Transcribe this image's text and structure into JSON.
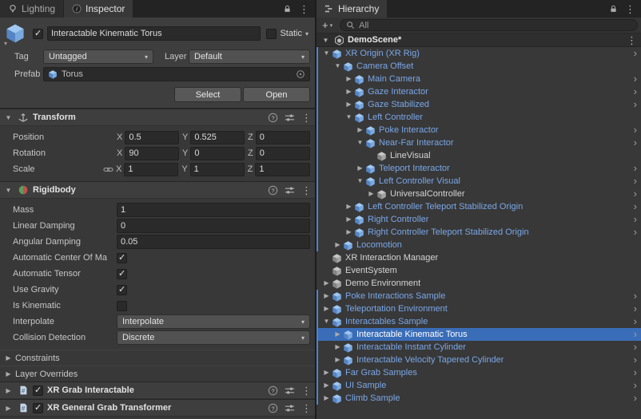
{
  "colors": {
    "selection": "#3a6db8",
    "prefab_text": "#7aa7e8",
    "prefab_bar": "#4f83cc"
  },
  "inspector": {
    "tabs": [
      "Lighting",
      "Inspector"
    ],
    "gameobject": {
      "name": "Interactable Kinematic Torus",
      "static_label": "Static",
      "tag_label": "Tag",
      "tag_value": "Untagged",
      "layer_label": "Layer",
      "layer_value": "Default",
      "prefab_label": "Prefab",
      "prefab_value": "Torus",
      "select_button": "Select",
      "open_button": "Open"
    },
    "transform": {
      "title": "Transform",
      "axis_labels": [
        "X",
        "Y",
        "Z"
      ],
      "rows": [
        {
          "label": "Position",
          "x": "0.5",
          "y": "0.525",
          "z": "0"
        },
        {
          "label": "Rotation",
          "x": "90",
          "y": "0",
          "z": "0"
        },
        {
          "label": "Scale",
          "x": "1",
          "y": "1",
          "z": "1"
        }
      ]
    },
    "rigidbody": {
      "title": "Rigidbody",
      "fields": [
        {
          "label": "Mass",
          "type": "text",
          "value": "1"
        },
        {
          "label": "Linear Damping",
          "type": "text",
          "value": "0"
        },
        {
          "label": "Angular Damping",
          "type": "text",
          "value": "0.05"
        },
        {
          "label": "Automatic Center Of Ma",
          "type": "checkbox",
          "checked": true
        },
        {
          "label": "Automatic Tensor",
          "type": "checkbox",
          "checked": true
        },
        {
          "label": "Use Gravity",
          "type": "checkbox",
          "checked": true
        },
        {
          "label": "Is Kinematic",
          "type": "checkbox",
          "checked": false
        },
        {
          "label": "Interpolate",
          "type": "dropdown",
          "value": "Interpolate"
        },
        {
          "label": "Collision Detection",
          "type": "dropdown",
          "value": "Discrete"
        }
      ],
      "foldouts": [
        "Constraints",
        "Layer Overrides"
      ]
    },
    "extra_components": [
      {
        "title": "XR Grab Interactable",
        "enabled": true
      },
      {
        "title": "XR General Grab Transformer",
        "enabled": true
      }
    ]
  },
  "hierarchy": {
    "tab": "Hierarchy",
    "add_button": "+",
    "search_value": "All",
    "scene": "DemoScene*",
    "rows": [
      {
        "label": "XR Origin (XR Rig)",
        "depth": 1,
        "children": true,
        "expanded": true,
        "icon": "prefab",
        "color": "prefab",
        "bar": true,
        "enter": true
      },
      {
        "label": "Camera Offset",
        "depth": 2,
        "children": true,
        "expanded": true,
        "icon": "prefab",
        "color": "prefab",
        "bar": true,
        "enter": false
      },
      {
        "label": "Main Camera",
        "depth": 3,
        "children": true,
        "expanded": false,
        "icon": "prefab",
        "color": "prefab",
        "bar": true,
        "enter": true
      },
      {
        "label": "Gaze Interactor",
        "depth": 3,
        "children": true,
        "expanded": false,
        "icon": "prefab",
        "color": "prefab",
        "bar": true,
        "enter": true
      },
      {
        "label": "Gaze Stabilized",
        "depth": 3,
        "children": true,
        "expanded": false,
        "icon": "prefab",
        "color": "prefab",
        "bar": true,
        "enter": true
      },
      {
        "label": "Left Controller",
        "depth": 3,
        "children": true,
        "expanded": true,
        "icon": "prefab",
        "color": "prefab",
        "bar": true,
        "enter": false
      },
      {
        "label": "Poke Interactor",
        "depth": 4,
        "children": true,
        "expanded": false,
        "icon": "prefab",
        "color": "prefab",
        "bar": true,
        "enter": true
      },
      {
        "label": "Near-Far Interactor",
        "depth": 4,
        "children": true,
        "expanded": true,
        "icon": "prefab",
        "color": "prefab",
        "bar": true,
        "enter": true
      },
      {
        "label": "LineVisual",
        "depth": 5,
        "children": false,
        "expanded": false,
        "icon": "plain",
        "color": "plain",
        "bar": true,
        "enter": false
      },
      {
        "label": "Teleport Interactor",
        "depth": 4,
        "children": true,
        "expanded": false,
        "icon": "prefab",
        "color": "prefab",
        "bar": true,
        "enter": true
      },
      {
        "label": "Left Controller Visual",
        "depth": 4,
        "children": true,
        "expanded": true,
        "icon": "prefab",
        "color": "prefab",
        "bar": true,
        "enter": true
      },
      {
        "label": "UniversalController",
        "depth": 5,
        "children": true,
        "expanded": false,
        "icon": "plain",
        "color": "plain",
        "bar": true,
        "enter": true
      },
      {
        "label": "Left Controller Teleport Stabilized Origin",
        "depth": 3,
        "children": true,
        "expanded": false,
        "icon": "prefab",
        "color": "prefab",
        "bar": true,
        "enter": true
      },
      {
        "label": "Right Controller",
        "depth": 3,
        "children": true,
        "expanded": false,
        "icon": "prefab",
        "color": "prefab",
        "bar": true,
        "enter": true
      },
      {
        "label": "Right Controller Teleport Stabilized Origin",
        "depth": 3,
        "children": true,
        "expanded": false,
        "icon": "prefab",
        "color": "prefab",
        "bar": true,
        "enter": true
      },
      {
        "label": "Locomotion",
        "depth": 2,
        "children": true,
        "expanded": false,
        "icon": "prefab",
        "color": "prefab",
        "bar": true,
        "enter": false
      },
      {
        "label": "XR Interaction Manager",
        "depth": 1,
        "children": false,
        "expanded": false,
        "icon": "plain",
        "color": "plain",
        "bar": false,
        "enter": false
      },
      {
        "label": "EventSystem",
        "depth": 1,
        "children": false,
        "expanded": false,
        "icon": "plain",
        "color": "plain",
        "bar": false,
        "enter": false
      },
      {
        "label": "Demo Environment",
        "depth": 1,
        "children": true,
        "expanded": false,
        "icon": "plain",
        "color": "plain",
        "bar": false,
        "enter": false
      },
      {
        "label": "Poke Interactions Sample",
        "depth": 1,
        "children": true,
        "expanded": false,
        "icon": "prefab",
        "color": "prefab",
        "bar": true,
        "enter": true
      },
      {
        "label": "Teleportation Environment",
        "depth": 1,
        "children": true,
        "expanded": false,
        "icon": "prefab",
        "color": "prefab",
        "bar": true,
        "enter": true
      },
      {
        "label": "Interactables Sample",
        "depth": 1,
        "children": true,
        "expanded": true,
        "icon": "prefab",
        "color": "prefab",
        "bar": true,
        "enter": true
      },
      {
        "label": "Interactable Kinematic Torus",
        "depth": 2,
        "children": true,
        "expanded": false,
        "icon": "prefab",
        "color": "prefab",
        "bar": true,
        "enter": true,
        "selected": true
      },
      {
        "label": "Interactable Instant Cylinder",
        "depth": 2,
        "children": true,
        "expanded": false,
        "icon": "prefab",
        "color": "prefab",
        "bar": true,
        "enter": true
      },
      {
        "label": "Interactable Velocity Tapered Cylinder",
        "depth": 2,
        "children": true,
        "expanded": false,
        "icon": "prefab",
        "color": "prefab",
        "bar": true,
        "enter": true
      },
      {
        "label": "Far Grab Samples",
        "depth": 1,
        "children": true,
        "expanded": false,
        "icon": "prefab",
        "color": "prefab",
        "bar": true,
        "enter": true
      },
      {
        "label": "UI Sample",
        "depth": 1,
        "children": true,
        "expanded": false,
        "icon": "prefab",
        "color": "prefab",
        "bar": true,
        "enter": true
      },
      {
        "label": "Climb Sample",
        "depth": 1,
        "children": true,
        "expanded": false,
        "icon": "prefab",
        "color": "prefab",
        "bar": true,
        "enter": true
      }
    ]
  }
}
